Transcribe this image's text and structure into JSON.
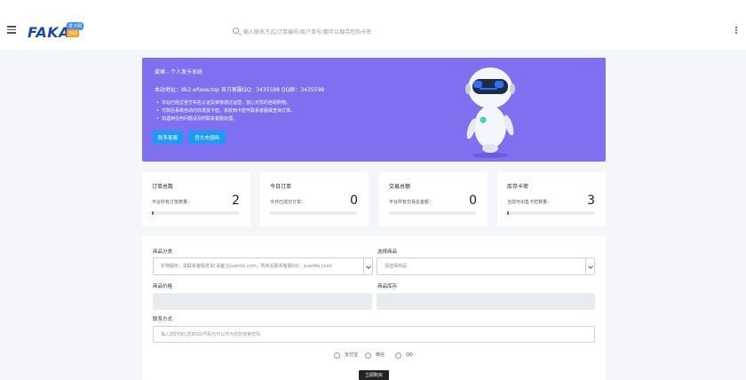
{
  "header": {
    "logo_text": "FAKA",
    "logo_badge_top": "发卡网",
    "logo_badge_bottom": "自动",
    "search_placeholder": "输入联系方式/订单编号/商户单号/都可以搜寻您的卡密"
  },
  "banner": {
    "title": "爱琳 - 个人发卡系统",
    "site_line": "本站地址：dk2.wfasw.top   官方客服QQ：3435598   QQ群：3435598",
    "notes": [
      "本站已经过官方实名认证及审核通过运营，放心无忧的自助购物。",
      "付款后系统自动向你发放卡密。未收到卡密可联系客服或查询订单。",
      "如遇到任何问题请及时联系客服处理。"
    ],
    "btn_contact": "联系客服",
    "btn_official": "官方充值网",
    "background_color": "#7e70ee"
  },
  "stats": [
    {
      "title": "订单总数",
      "label": "平台所有订单数量：",
      "value": "2",
      "progress": 0.02
    },
    {
      "title": "今日订单",
      "label": "今日已成交订单：",
      "value": "0",
      "progress": 0
    },
    {
      "title": "交易总额",
      "label": "平台所有交易总金额：",
      "value": "0",
      "progress": 0
    },
    {
      "title": "库存卡密",
      "label": "当前可出售卡密数量：",
      "value": "3",
      "progress": 0.02
    }
  ],
  "form": {
    "category_label": "商品分类",
    "category_value": "实物服务：需联系客服发货(请备注yuanbo.com，购买后联系客服QQ：yuanbo.com)",
    "product_label": "选择商品",
    "product_value": "请选择商品",
    "price_label": "商品价格",
    "stock_label": "商品库存",
    "contact_label": "联系方式",
    "contact_placeholder": "输入您的QQ,您的QQ号码也可以作为您的搜索密码",
    "payment_options": [
      "支付宝",
      "微信",
      "QQ"
    ],
    "buy_button": "立即购买"
  }
}
